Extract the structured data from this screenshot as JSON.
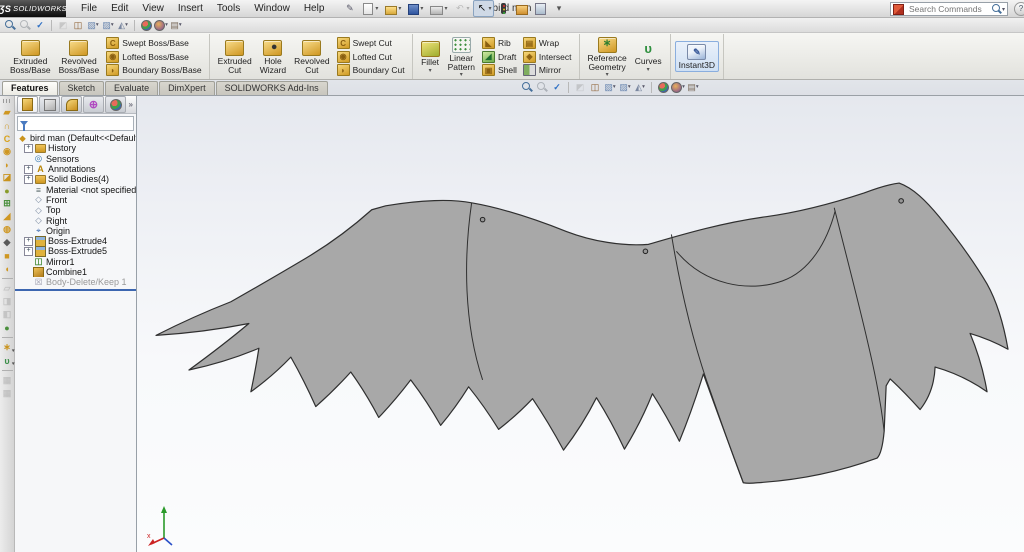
{
  "titlebar": {
    "logo_mark": "ƷS",
    "logo_text": "SOLIDWORKS",
    "menus": [
      "File",
      "Edit",
      "View",
      "Insert",
      "Tools",
      "Window",
      "Help"
    ],
    "title": "bird man",
    "search_placeholder": "Search Commands",
    "help_glyph": "?"
  },
  "quick_access": [
    {
      "n": "sketch-pen",
      "icon": "pen"
    },
    {
      "n": "new-file",
      "icon": "doc",
      "dd": true
    },
    {
      "n": "open-file",
      "icon": "folder",
      "dd": true
    },
    {
      "n": "save",
      "icon": "save",
      "dd": true
    },
    {
      "n": "print",
      "icon": "print",
      "dd": true
    },
    {
      "n": "undo",
      "icon": "undo",
      "dd": true,
      "grayed": true
    },
    {
      "n": "select",
      "icon": "cursor",
      "dd": true,
      "pressed": true
    },
    {
      "n": "rebuild",
      "icon": "traffic"
    },
    {
      "n": "options",
      "icon": "options"
    },
    {
      "n": "file-properties",
      "icon": "props"
    },
    {
      "n": "toolbar-overflow",
      "icon": "dd"
    }
  ],
  "view_tools": [
    {
      "n": "zoom-to-fit",
      "icon": "mag"
    },
    {
      "n": "zoom-to-area",
      "icon": "mag",
      "grayed": true
    },
    {
      "n": "zoom-to-selection",
      "icon": "check"
    },
    {
      "sep": true
    },
    {
      "n": "previous-view",
      "icon": "prev",
      "grayed": true
    },
    {
      "n": "section-view",
      "icon": "section"
    },
    {
      "n": "view-orientation",
      "icon": "cube",
      "dd": true
    },
    {
      "n": "display-style",
      "icon": "cube2",
      "dd": true
    },
    {
      "n": "hide-show-items",
      "icon": "hide",
      "dd": true
    },
    {
      "sep": true
    },
    {
      "n": "edit-appearance",
      "icon": "ball"
    },
    {
      "n": "apply-scene",
      "icon": "scene",
      "dd": true
    },
    {
      "n": "view-settings",
      "icon": "camera",
      "dd": true
    }
  ],
  "ribbon": {
    "groups": [
      {
        "big": [
          {
            "n": "extruded-boss-base",
            "lines": [
              "Extruded",
              "Boss/Base"
            ],
            "icon": "ext-boss"
          },
          {
            "n": "revolved-boss-base",
            "lines": [
              "Revolved",
              "Boss/Base"
            ],
            "icon": "rev-boss"
          }
        ],
        "stacks": [
          [
            {
              "n": "swept-boss-base",
              "label": "Swept Boss/Base",
              "icon": "default",
              "g": "C"
            },
            {
              "n": "lofted-boss-base",
              "label": "Lofted Boss/Base",
              "icon": "default",
              "g": "◉"
            },
            {
              "n": "boundary-boss-base",
              "label": "Boundary Boss/Base",
              "icon": "default",
              "g": "◗"
            }
          ]
        ]
      },
      {
        "big": [
          {
            "n": "extruded-cut",
            "lines": [
              "Extruded",
              "Cut"
            ],
            "icon": "ext-cut"
          },
          {
            "n": "hole-wizard",
            "lines": [
              "Hole",
              "Wizard"
            ],
            "icon": "hole"
          },
          {
            "n": "revolved-cut",
            "lines": [
              "Revolved",
              "Cut"
            ],
            "icon": "rev-cut"
          }
        ],
        "stacks": [
          [
            {
              "n": "swept-cut",
              "label": "Swept Cut",
              "icon": "default",
              "g": "C"
            },
            {
              "n": "lofted-cut",
              "label": "Lofted Cut",
              "icon": "default",
              "g": "◉"
            },
            {
              "n": "boundary-cut",
              "label": "Boundary Cut",
              "icon": "default",
              "g": "◗"
            }
          ]
        ]
      },
      {
        "big": [
          {
            "n": "fillet",
            "lines": [
              "Fillet"
            ],
            "icon": "fillet",
            "dd": true
          },
          {
            "n": "linear-pattern",
            "lines": [
              "Linear",
              "Pattern"
            ],
            "icon": "pattern",
            "dd": true
          }
        ],
        "stacks": [
          [
            {
              "n": "rib",
              "label": "Rib",
              "icon": "default",
              "g": "◣"
            },
            {
              "n": "draft",
              "label": "Draft",
              "icon": "green",
              "g": "◢"
            },
            {
              "n": "shell",
              "label": "Shell",
              "icon": "default",
              "g": "▣"
            }
          ],
          [
            {
              "n": "wrap",
              "label": "Wrap",
              "icon": "default",
              "g": "▤"
            },
            {
              "n": "intersect",
              "label": "Intersect",
              "icon": "default",
              "g": "◈"
            },
            {
              "n": "mirror",
              "label": "Mirror",
              "icon": "mirror",
              "g": ""
            }
          ]
        ]
      },
      {
        "big": [
          {
            "n": "reference-geometry",
            "lines": [
              "Reference",
              "Geometry"
            ],
            "icon": "refgeo",
            "dd": true,
            "g": "∗"
          },
          {
            "n": "curves",
            "lines": [
              "Curves"
            ],
            "icon": "curves",
            "dd": true,
            "g": "υ"
          }
        ]
      },
      {
        "big": [
          {
            "n": "instant3d",
            "lines": [
              "Instant3D"
            ],
            "icon": "instant3d",
            "pressed": true,
            "g": "✎"
          }
        ]
      }
    ]
  },
  "tabs": {
    "items": [
      "Features",
      "Sketch",
      "Evaluate",
      "DimXpert",
      "SOLIDWORKS Add-Ins"
    ],
    "active": 0
  },
  "feature_panel": {
    "manager_tabs": [
      "featuremanager",
      "propertymanager",
      "configurationmanager",
      "dimxpertmanager",
      "displaymanager"
    ],
    "active_tab": 0,
    "overflow_glyph": "»",
    "tree": [
      {
        "label": "bird man (Default<<Default>_Dis",
        "icon": "part",
        "root": true
      },
      {
        "label": "History",
        "icon": "history",
        "expand": true
      },
      {
        "label": "Sensors",
        "icon": "sensors"
      },
      {
        "label": "Annotations",
        "icon": "annotations",
        "expand": true
      },
      {
        "label": "Solid Bodies(4)",
        "icon": "bodies",
        "expand": true
      },
      {
        "label": "Material <not specified>",
        "icon": "material"
      },
      {
        "label": "Front",
        "icon": "plane"
      },
      {
        "label": "Top",
        "icon": "plane"
      },
      {
        "label": "Right",
        "icon": "plane"
      },
      {
        "label": "Origin",
        "icon": "origin"
      },
      {
        "label": "Boss-Extrude4",
        "icon": "extrude",
        "expand": true
      },
      {
        "label": "Boss-Extrude5",
        "icon": "extrude",
        "expand": true
      },
      {
        "label": "Mirror1",
        "icon": "mirror"
      },
      {
        "label": "Combine1",
        "icon": "combine"
      },
      {
        "label": "Body-Delete/Keep 1",
        "icon": "bodydelete",
        "grayed": true
      }
    ]
  },
  "left_toolbar": [
    {
      "grip": true
    },
    {
      "n": "extruded-boss",
      "g": "▰",
      "c": "#cf9722"
    },
    {
      "n": "revolved-boss",
      "g": "∩",
      "c": "#cf9722"
    },
    {
      "n": "swept-boss",
      "g": "C",
      "c": "#d8a21a"
    },
    {
      "n": "lofted-boss",
      "g": "◉",
      "c": "#cf9722"
    },
    {
      "n": "boundary-boss",
      "g": "◗",
      "c": "#cf9722"
    },
    {
      "n": "extruded-cut",
      "g": "◪",
      "c": "#c9931d"
    },
    {
      "n": "fillet",
      "g": "●",
      "c": "#8a9c2a"
    },
    {
      "n": "linear-pattern",
      "g": "⊞",
      "c": "#4a8f3c"
    },
    {
      "n": "draft",
      "g": "◢",
      "c": "#cf9722"
    },
    {
      "n": "shell",
      "g": "◍",
      "c": "#cf9722"
    },
    {
      "n": "rib",
      "g": "◆",
      "c": "#5a5a5a"
    },
    {
      "n": "combine",
      "g": "■",
      "c": "#cf9722"
    },
    {
      "n": "wrap",
      "g": "◖",
      "c": "#cf9722"
    },
    {
      "sep": true
    },
    {
      "n": "move-face",
      "g": "▱",
      "c": "#999",
      "grayed": true
    },
    {
      "n": "delete-face",
      "g": "◨",
      "c": "#999",
      "grayed": true
    },
    {
      "n": "replace-face",
      "g": "◧",
      "c": "#999",
      "grayed": true
    },
    {
      "n": "appearance",
      "g": "●",
      "c": "#4a8f3c"
    },
    {
      "sep": true
    },
    {
      "n": "reference-geometry",
      "g": "∗",
      "c": "#c9931d",
      "dd": true
    },
    {
      "n": "curves",
      "g": "υ",
      "c": "#3c8f4a",
      "dd": true
    },
    {
      "sep": true
    },
    {
      "n": "sketch-picture",
      "g": "▦",
      "c": "#999",
      "grayed": true
    },
    {
      "n": "sketch-picture-2",
      "g": "▦",
      "c": "#999",
      "grayed": true
    }
  ],
  "viewport": {
    "part_fill": "#a8a8a8",
    "edge_color": "#2f2f2f",
    "hole_points": [
      [
        482,
        216
      ],
      [
        645,
        248
      ],
      [
        901,
        197
      ]
    ],
    "triad": {
      "x_label": "x",
      "x_color": "#cc2222",
      "y_color": "#2a9a2a",
      "z_color": "#2a50c8"
    }
  }
}
